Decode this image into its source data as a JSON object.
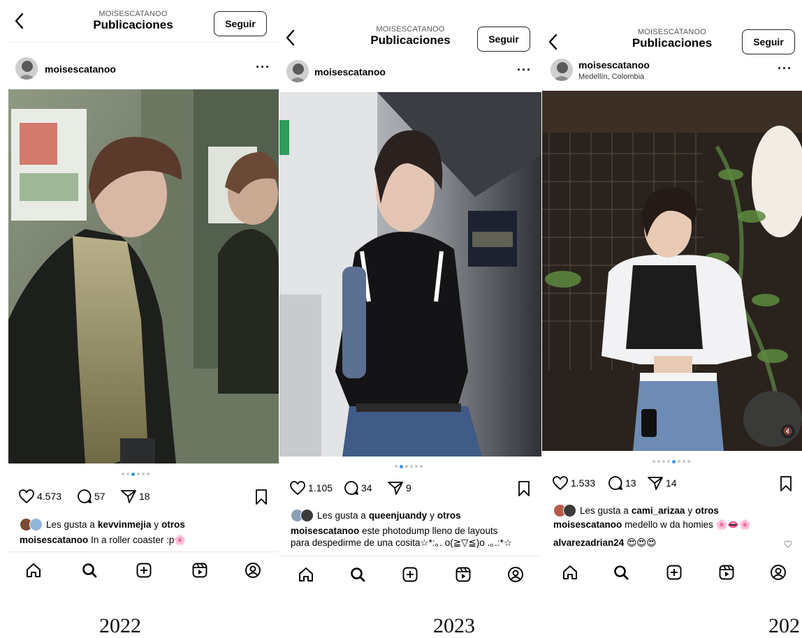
{
  "panels": [
    {
      "header": {
        "username_caps": "MOISESCATANOO",
        "title": "Publicaciones",
        "follow_label": "Seguir"
      },
      "user": {
        "name": "moisescatanoo",
        "location": ""
      },
      "carousel": {
        "active_index": 2,
        "count": 6
      },
      "actions": {
        "likes": "4.573",
        "comments": "57",
        "shares": "18"
      },
      "liked_by": {
        "prefix": "Les gusta a",
        "user": "kevvinmejia",
        "joiner": "y",
        "others": "otros"
      },
      "caption": {
        "user": "moisescatanoo",
        "text": "In a roller coaster :p🌸"
      },
      "year": "2022"
    },
    {
      "header": {
        "username_caps": "MOISESCATANOO",
        "title": "Publicaciones",
        "follow_label": "Seguir"
      },
      "user": {
        "name": "moisescatanoo",
        "location": ""
      },
      "carousel": {
        "active_index": 1,
        "count": 6
      },
      "actions": {
        "likes": "1.105",
        "comments": "34",
        "shares": "9"
      },
      "liked_by": {
        "prefix": "Les gusta a",
        "user": "queenjuandy",
        "joiner": "y",
        "others": "otros"
      },
      "caption": {
        "user": "moisescatanoo",
        "text": "este photodump lleno de layouts",
        "line2": "para despedirme de una cosita☆*:｡. o(≧▽≦)o .｡.:*☆"
      },
      "year": "2023"
    },
    {
      "header": {
        "username_caps": "MOISESCATANOO",
        "title": "Publicaciones",
        "follow_label": "Seguir"
      },
      "user": {
        "name": "moisescatanoo",
        "location": "Medellín, Colombia"
      },
      "carousel": {
        "active_index": 4,
        "count": 8
      },
      "actions": {
        "likes": "1.533",
        "comments": "13",
        "shares": "14"
      },
      "liked_by": {
        "prefix": "Les gusta a",
        "user": "cami_arizaa",
        "joiner": "y",
        "others": "otros"
      },
      "caption": {
        "user": "moisescatanoo",
        "text": "medello w da homies 🌸👄🌸"
      },
      "comment": {
        "user": "alvarezadrian24",
        "text": "😍😍😍"
      },
      "year": "202"
    }
  ],
  "icons": [
    "chevron-left-icon",
    "more-icon",
    "heart-icon",
    "comment-icon",
    "share-icon",
    "bookmark-icon",
    "home-icon",
    "search-icon",
    "create-icon",
    "reels-icon",
    "profile-icon",
    "mute-icon"
  ],
  "colors": {
    "carousel_active": "#3897f0",
    "text": "#000000",
    "divider": "#e6e6e6"
  }
}
